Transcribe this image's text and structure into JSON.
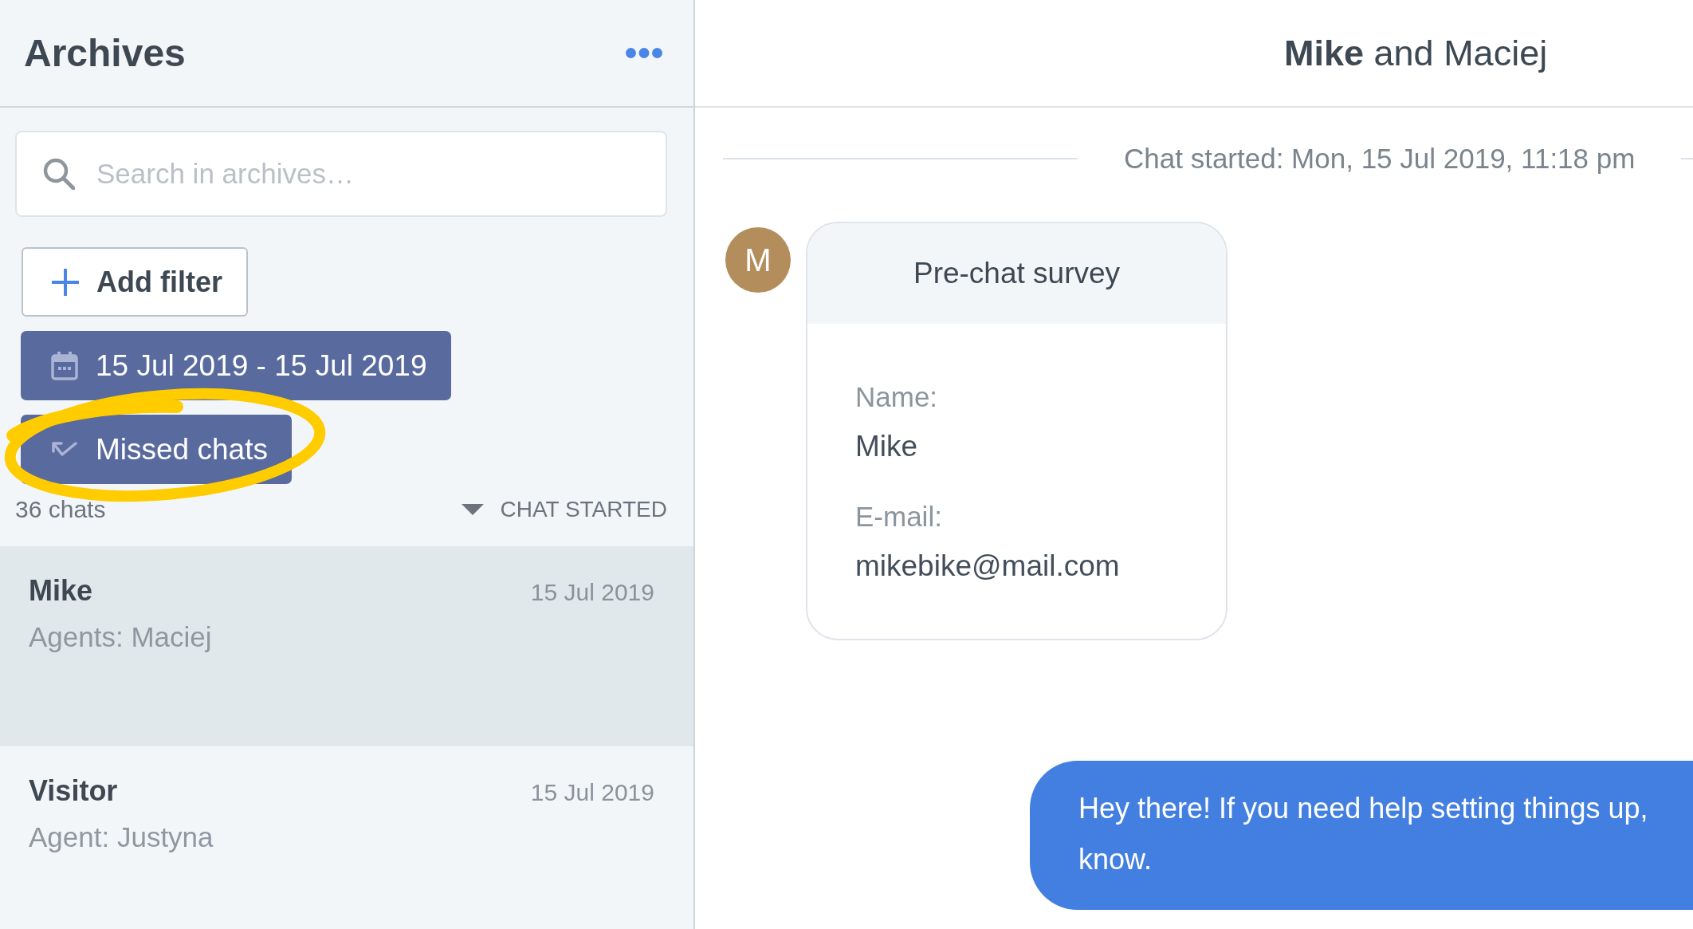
{
  "sidebar": {
    "title": "Archives",
    "search": {
      "placeholder": "Search in archives…"
    },
    "add_filter_button": "Add filter",
    "filters": [
      {
        "kind": "date",
        "label": "15 Jul 2019 - 15 Jul 2019",
        "highlighted": false
      },
      {
        "kind": "missed",
        "label": "Missed chats",
        "highlighted": true
      }
    ],
    "chat_count": "36 chats",
    "sort": {
      "label": "CHAT STARTED"
    },
    "chats": [
      {
        "name": "Mike",
        "date": "15 Jul 2019",
        "agents": "Agents: Maciej",
        "selected": true
      },
      {
        "name": "Visitor",
        "date": "15 Jul 2019",
        "agents": "Agent: Justyna",
        "selected": false
      }
    ]
  },
  "conversation": {
    "title": "**Mike** and Maciej",
    "started": "Chat started: Mon, 15 Jul 2019, 11:18 pm",
    "survey": {
      "avatar": "M",
      "title": "Pre-chat survey",
      "fields": [
        {
          "label": "Name:",
          "value": "Mike"
        },
        {
          "label": "E-mail:",
          "value": "mikebike@mail.com"
        }
      ]
    },
    "message": {
      "text": "Hey there! If you need help setting things up,\nknow."
    }
  }
}
